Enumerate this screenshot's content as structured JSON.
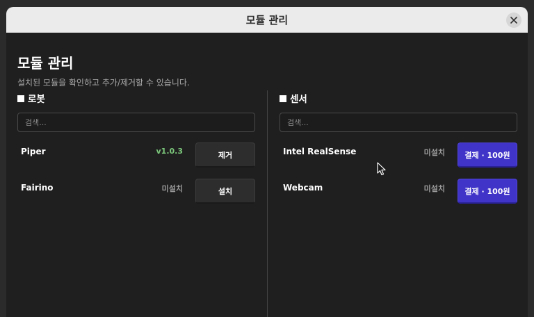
{
  "window": {
    "title": "모듈 관리"
  },
  "main": {
    "heading": "모듈 관리",
    "subheading": "설치된 모듈을 확인하고 추가/제거할 수 있습니다."
  },
  "robots": {
    "title": "로봇",
    "search_placeholder": "검색...",
    "items": [
      {
        "name": "Piper",
        "status": "v1.0.3",
        "action": "제거"
      },
      {
        "name": "Fairino",
        "status": "미설치",
        "action": "설치"
      }
    ]
  },
  "sensors": {
    "title": "센서",
    "search_placeholder": "검색...",
    "items": [
      {
        "name": "Intel RealSense",
        "status": "미설치",
        "action": "결제 · 100원"
      },
      {
        "name": "Webcam",
        "status": "미설치",
        "action": "결제 · 100원"
      }
    ]
  },
  "colors": {
    "primary_button": "#3f33c8",
    "installed_status": "#7bc67b",
    "not_installed_status": "#9a9a9a"
  },
  "icons": {
    "close": "close-icon",
    "cursor": "mouse-pointer-icon"
  }
}
